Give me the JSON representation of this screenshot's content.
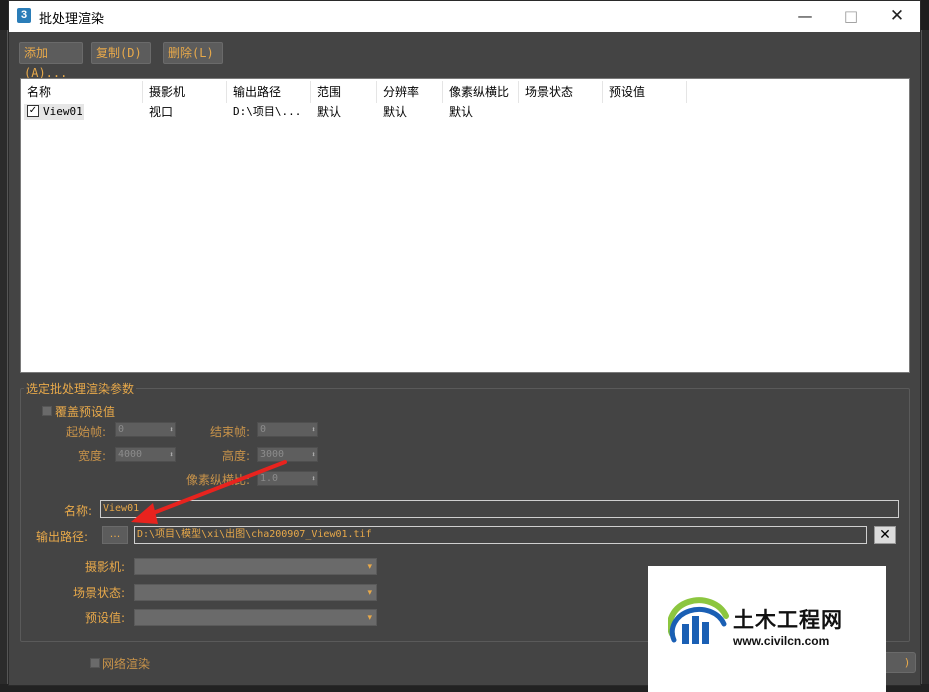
{
  "window": {
    "title": "批处理渲染",
    "app_icon_label": "3",
    "controls": {
      "minimize": "—",
      "maximize": "□",
      "close": "✕"
    }
  },
  "toolbar": {
    "add_label": "添加(A)...",
    "copy_label": "复制(D)",
    "delete_label": "删除(L)"
  },
  "list": {
    "columns": [
      "名称",
      "摄影机",
      "输出路径",
      "范围",
      "分辨率",
      "像素纵横比",
      "场景状态",
      "预设值"
    ],
    "rows": [
      {
        "checked": "✓",
        "name": "View01",
        "camera": "视口",
        "output": "D:\\项目\\...",
        "range": "默认",
        "resolution": "默认",
        "aspect": "默认",
        "state": "",
        "preset": ""
      }
    ]
  },
  "params": {
    "group_title": "选定批处理渲染参数",
    "override_label": "覆盖预设值",
    "start_frame_label": "起始帧:",
    "start_frame_value": "0",
    "end_frame_label": "结束帧:",
    "end_frame_value": "0",
    "width_label": "宽度:",
    "width_value": "4000",
    "height_label": "高度:",
    "height_value": "3000",
    "aspect_label": "像素纵横比:",
    "aspect_value": "1.0",
    "name_label": "名称:",
    "name_value": "View01",
    "output_label": "输出路径:",
    "browse_label": "...",
    "output_value": "D:\\项目\\模型\\xi\\出图\\cha200907_View01.tif",
    "clear_label": "✕",
    "camera_label": "摄影机:",
    "state_label": "场景状态:",
    "preset_label": "预设值:",
    "dropdown_arrow": "▾"
  },
  "footer": {
    "net_render_label": "网络渲染",
    "render_button_label": ")"
  },
  "watermark": {
    "title": "土木工程网",
    "url": "www.civilcn.com"
  },
  "colors": {
    "accent": "#e8a94a",
    "panel": "#444444",
    "arrow": "#e8231e",
    "logo_blue": "#1a5fb4",
    "logo_green": "#8cc63f"
  }
}
